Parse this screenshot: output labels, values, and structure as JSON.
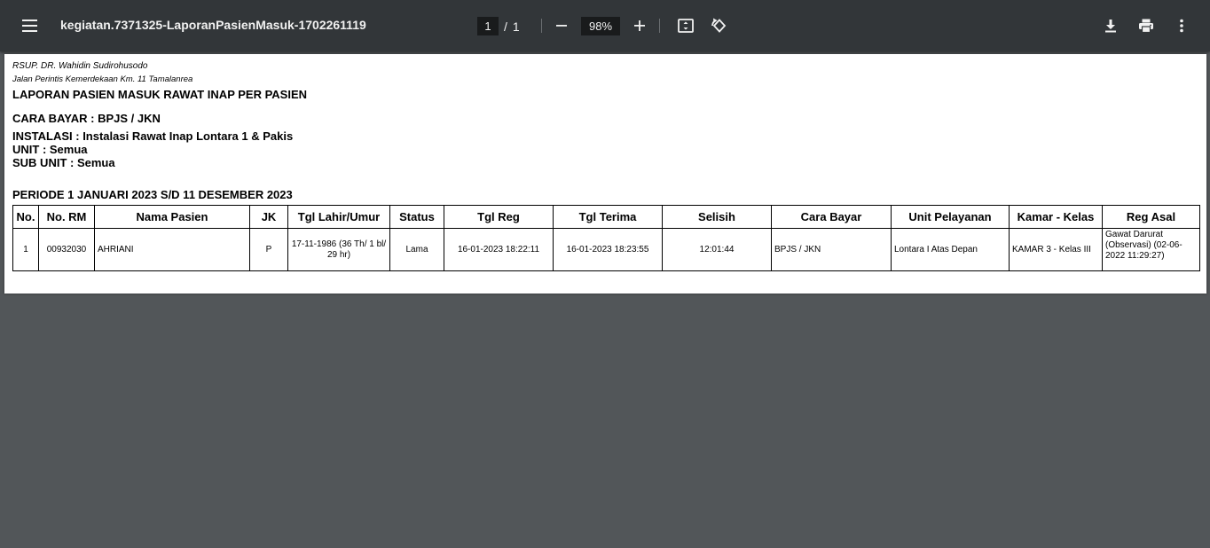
{
  "toolbar": {
    "title": "kegiatan.7371325-LaporanPasienMasuk-1702261119",
    "current_page": "1",
    "page_separator": "/",
    "total_pages": "1",
    "zoom": "98%"
  },
  "report": {
    "hospital": "RSUP. DR. Wahidin Sudirohusodo",
    "address": "Jalan Perintis Kemerdekaan Km. 11 Tamalanrea",
    "title": "LAPORAN PASIEN MASUK RAWAT INAP PER PASIEN",
    "cara_bayar": "CARA BAYAR : BPJS / JKN",
    "instalasi": "INSTALASI : Instalasi Rawat Inap Lontara 1 & Pakis",
    "unit": "UNIT : Semua",
    "sub_unit": "SUB UNIT : Semua",
    "periode": "PERIODE 1 JANUARI 2023 S/D 11 DESEMBER 2023"
  },
  "table": {
    "headers": [
      "No.",
      "No. RM",
      "Nama Pasien",
      "JK",
      "Tgl Lahir/Umur",
      "Status",
      "Tgl Reg",
      "Tgl Terima",
      "Selisih",
      "Cara Bayar",
      "Unit Pelayanan",
      "Kamar - Kelas",
      "Reg Asal"
    ],
    "rows": [
      {
        "no": "1",
        "no_rm": "00932030",
        "nama": "AHRIANI",
        "jk": "P",
        "tgl_lahir": "17-11-1986 (36 Th/ 1 bl/ 29 hr)",
        "status": "Lama",
        "tgl_reg": "16-01-2023 18:22:11",
        "tgl_terima": "16-01-2023 18:23:55",
        "selisih": "12:01:44",
        "cara_bayar": "BPJS / JKN",
        "unit_pelayanan": "Lontara I Atas Depan",
        "kamar_kelas": "KAMAR 3 - Kelas III",
        "reg_asal": "Gawat Darurat (Observasi) (02-06-2022 11:29:27)"
      }
    ]
  },
  "icons": {
    "menu": "menu-icon",
    "zoom_out": "minus-icon",
    "zoom_in": "plus-icon",
    "fit": "fit-to-page-icon",
    "rotate": "rotate-icon",
    "download": "download-icon",
    "print": "print-icon",
    "more": "more-vert-icon"
  },
  "colors": {
    "toolbar_bg": "#323639",
    "viewer_bg": "#525659",
    "page_bg": "#ffffff"
  }
}
